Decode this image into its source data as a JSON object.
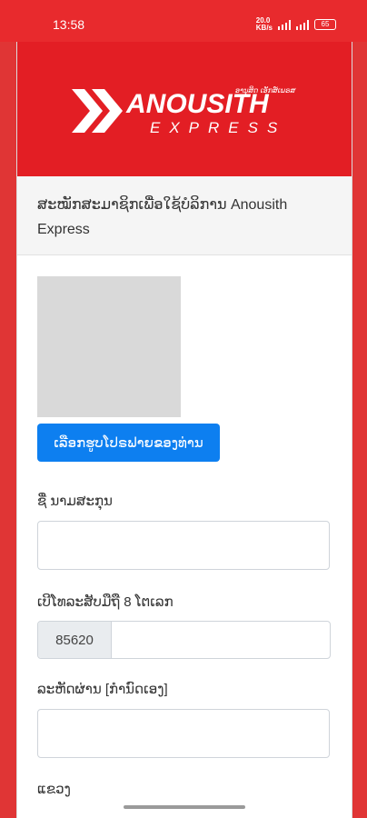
{
  "status_bar": {
    "time": "13:58",
    "net_speed_top": "20.0",
    "net_speed_bottom": "KB/s",
    "battery": "65"
  },
  "header": {
    "brand_name": "ANOUSITH",
    "brand_sub": "EXPRESS",
    "brand_tagline": "ອານຸສິດ ເອັກສ໌ເພຣສ"
  },
  "registration": {
    "subtitle": "ສະໝັກສະມາຊິກເພື່ອໃຊ້ບໍລິການ Anousith Express",
    "choose_photo_label": "ເລືອກຮູບໂປຣຟາຍຂອງທ່ານ",
    "name_label": "ຊື່ ນາມສະກຸນ",
    "name_value": "",
    "phone_label": "ເບີໂທລະສັບມືຖື 8 ໂຕເລກ",
    "phone_prefix": "85620",
    "phone_value": "",
    "password_label": "ລະຫັດຜ່ານ [ກໍານົດເອງ]",
    "password_value": "",
    "province_label": "ແຂວງ"
  },
  "colors": {
    "brand_red": "#e31e24",
    "button_blue": "#0d7ff0"
  }
}
